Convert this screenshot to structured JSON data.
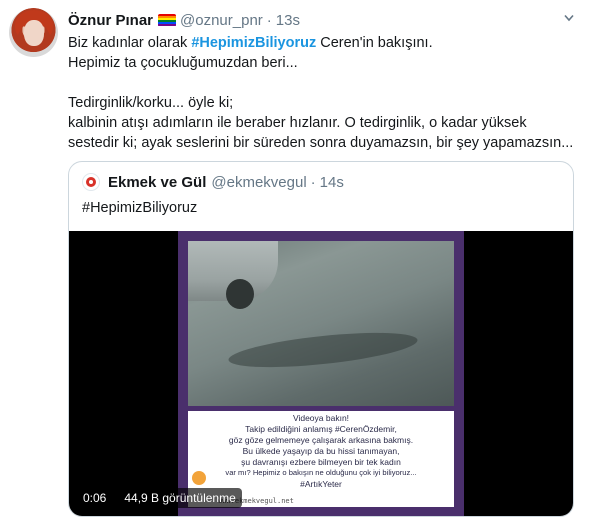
{
  "tweet": {
    "display_name": "Öznur Pınar",
    "flag_icon": "rainbow-flag-icon",
    "flag_colors": [
      "#e40303",
      "#ff8c00",
      "#ffed00",
      "#008026",
      "#004dff",
      "#750787"
    ],
    "handle": "@oznur_pnr",
    "separator": "·",
    "time": "13s",
    "lines": [
      {
        "before": "Biz kadınlar olarak ",
        "hashtag": "#HepimizBiliyoruz",
        "after": " Ceren'in bakışını."
      },
      {
        "text": "Hepimiz ta çocukluğumuzdan beri..."
      },
      {
        "text": ""
      },
      {
        "text": "Tedirginlik/korku... öyle ki;"
      },
      {
        "text": "kalbinin atışı adımların ile beraber hızlanır. O tedirginlik, o kadar yüksek"
      },
      {
        "text": "sestedir ki; ayak seslerini bir süreden sonra duyamazsın, bir şey yapamazsın..."
      }
    ]
  },
  "quote": {
    "display_name": "Ekmek ve Gül",
    "handle": "@ekmekvegul",
    "separator": "·",
    "time": "14s",
    "text": "#HepimizBiliyoruz",
    "video": {
      "caption_lines": [
        "Videoya bakın!",
        "Takip edildiğini anlamış #CerenÖzdemir,",
        "göz göze gelmemeye çalışarak arkasına bakmış.",
        "Bu ülkede yaşayıp da bu hissi tanımayan,",
        "şu davranışı ezbere bilmeyen bir tek kadın",
        "var mı? Hepimiz o bakışın ne olduğunu çok iyi biliyoruz...",
        "#ArtıkYeter"
      ],
      "url": "www.ekmekvegul.net",
      "elapsed": "0:06",
      "views": "44,9 B görüntülenme"
    }
  },
  "colors": {
    "link": "#1b95e0",
    "secondary": "#657786",
    "border": "#ccd6dd",
    "frame_purple": "#4a2f6c"
  }
}
